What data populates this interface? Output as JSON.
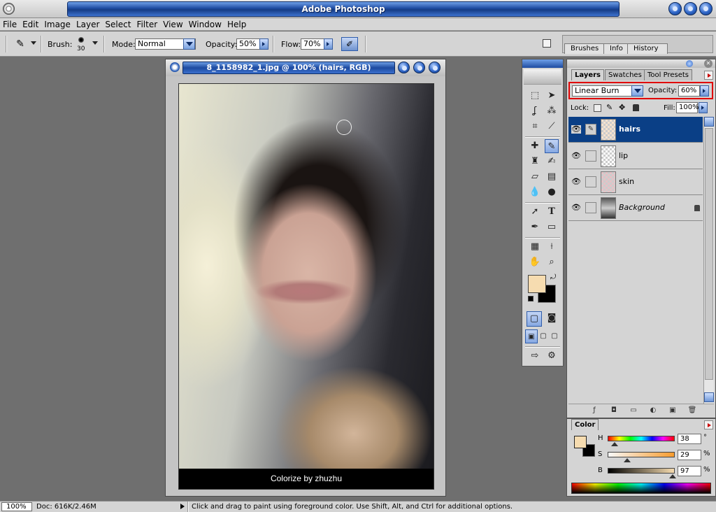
{
  "app": {
    "title": "Adobe Photoshop"
  },
  "menu": [
    "File",
    "Edit",
    "Image",
    "Layer",
    "Select",
    "Filter",
    "View",
    "Window",
    "Help"
  ],
  "options": {
    "brush_label": "Brush:",
    "brush_size": "30",
    "mode_label": "Mode:",
    "mode_value": "Normal",
    "opacity_label": "Opacity:",
    "opacity_value": "50%",
    "flow_label": "Flow:",
    "flow_value": "70%"
  },
  "palette_well": {
    "tabs": [
      "Brushes",
      "Info",
      "History"
    ]
  },
  "document": {
    "title": "8_1158982_1.jpg @ 100% (hairs, RGB)",
    "credit": "Colorize by zhuzhu"
  },
  "toolbox": {
    "tools": [
      "marquee",
      "move",
      "lasso",
      "magic-wand",
      "crop",
      "slice",
      "healing",
      "brush",
      "stamp",
      "history-brush",
      "eraser",
      "gradient",
      "blur",
      "dodge",
      "path-select",
      "type",
      "pen",
      "shape",
      "notes",
      "eyedropper",
      "hand",
      "zoom"
    ],
    "selected_tool": "brush",
    "foreground_color": "#f6dcb0",
    "background_color": "#000000"
  },
  "layers_panel": {
    "tabs": [
      "Layers",
      "Swatches",
      "Tool Presets"
    ],
    "blend_mode": "Linear Burn",
    "opacity_label": "Opacity:",
    "opacity_value": "60%",
    "lock_label": "Lock:",
    "fill_label": "Fill:",
    "fill_value": "100%",
    "layers": [
      {
        "name": "hairs",
        "selected": true
      },
      {
        "name": "lip",
        "selected": false
      },
      {
        "name": "skin",
        "selected": false
      },
      {
        "name": "Background",
        "selected": false,
        "locked": true
      }
    ]
  },
  "color_panel": {
    "tab": "Color",
    "h_label": "H",
    "h_value": "38",
    "h_unit": "°",
    "s_label": "S",
    "s_value": "29",
    "s_unit": "%",
    "b_label": "B",
    "b_value": "97",
    "b_unit": "%"
  },
  "statusbar": {
    "zoom": "100%",
    "doc": "Doc: 616K/2.46M",
    "hint": "Click and drag to paint using foreground color.  Use Shift, Alt, and Ctrl for additional options."
  }
}
